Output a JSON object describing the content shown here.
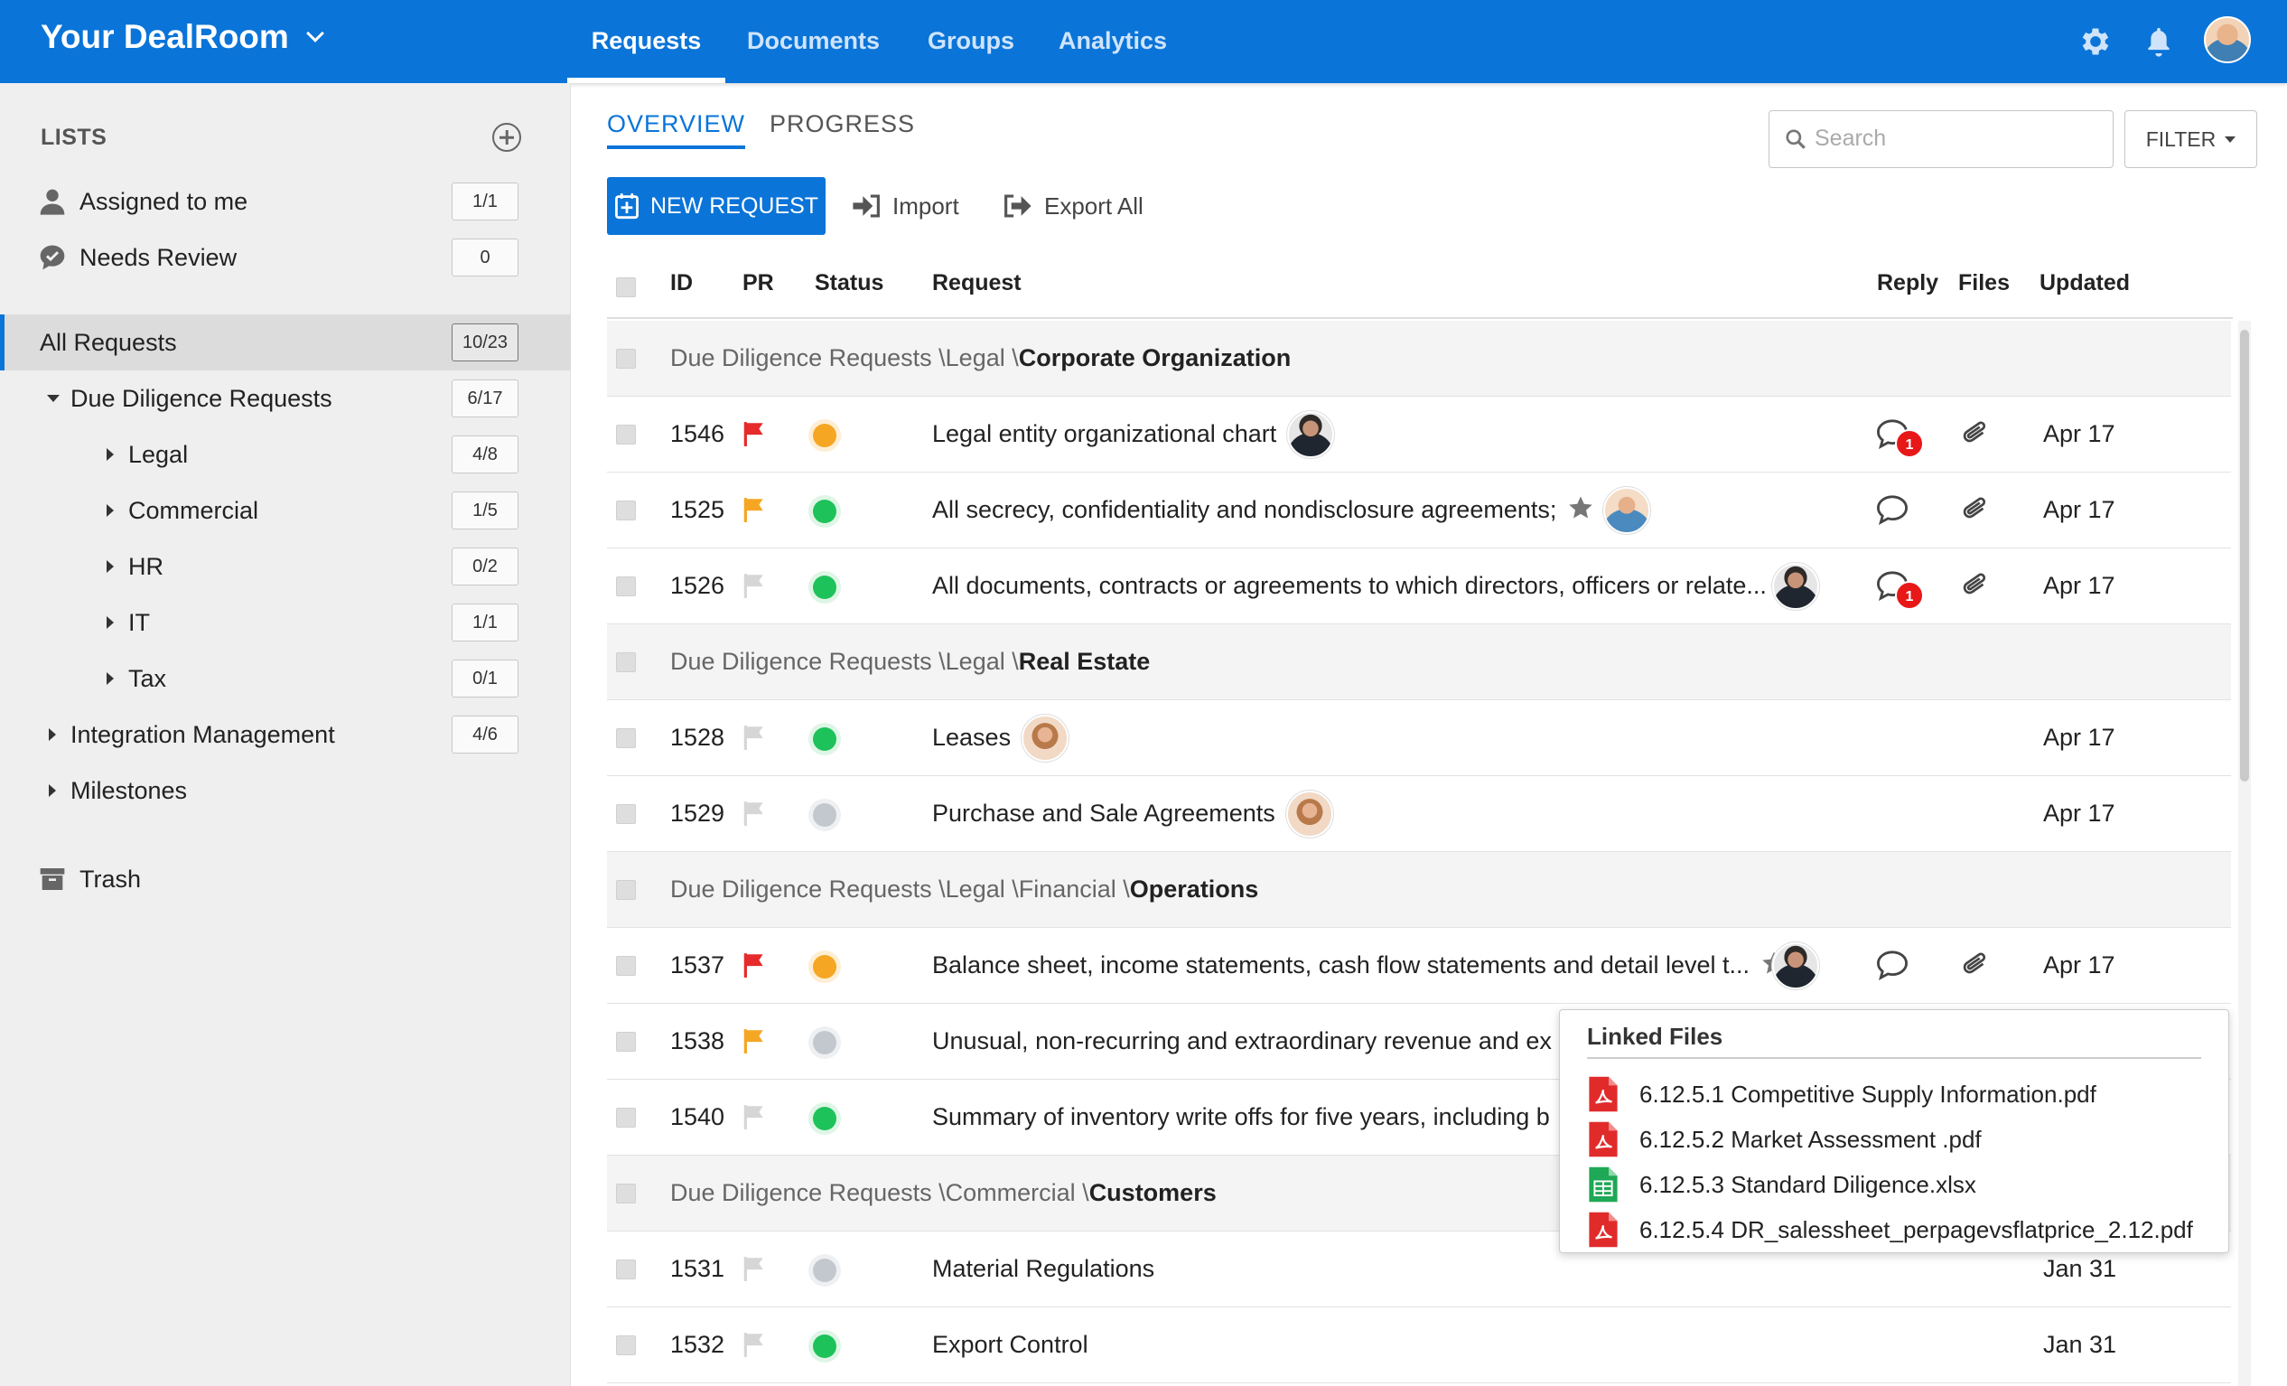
{
  "header": {
    "brand": "Your DealRoom",
    "tabs": [
      {
        "label": "Requests",
        "active": true
      },
      {
        "label": "Documents",
        "active": false
      },
      {
        "label": "Groups",
        "active": false
      },
      {
        "label": "Analytics",
        "active": false
      }
    ],
    "icons": [
      "gear-icon",
      "bell-icon",
      "user-avatar"
    ]
  },
  "sidebar": {
    "heading": "LISTS",
    "quick": [
      {
        "label": "Assigned to me",
        "count": "1/1",
        "icon": "user-icon"
      },
      {
        "label": "Needs Review",
        "count": "0",
        "icon": "chat-check-icon"
      }
    ],
    "tree": [
      {
        "label": "All Requests",
        "count": "10/23",
        "selected": true
      },
      {
        "label": "Due Diligence Requests",
        "count": "6/17",
        "expanded": true
      },
      {
        "label": "Legal",
        "count": "4/8"
      },
      {
        "label": "Commercial",
        "count": "1/5"
      },
      {
        "label": "HR",
        "count": "0/2"
      },
      {
        "label": "IT",
        "count": "1/1"
      },
      {
        "label": "Tax",
        "count": "0/1"
      },
      {
        "label": "Integration Management",
        "count": "4/6"
      },
      {
        "label": "Milestones",
        "count": ""
      }
    ],
    "trash": "Trash"
  },
  "main": {
    "subtabs": [
      {
        "label": "OVERVIEW",
        "active": true
      },
      {
        "label": "PROGRESS",
        "active": false
      }
    ],
    "search_placeholder": "Search",
    "filter_label": "FILTER",
    "new_request_label": "NEW REQUEST",
    "import_label": "Import",
    "export_label": "Export All",
    "columns": {
      "id": "ID",
      "pr": "PR",
      "status": "Status",
      "request": "Request",
      "reply": "Reply",
      "files": "Files",
      "updated": "Updated"
    }
  },
  "groups": [
    {
      "path": "Due Diligence Requests \\Legal \\",
      "name": "Corporate Organization",
      "rows": [
        {
          "id": "1546",
          "flag": "red",
          "status": "orange",
          "title": "Legal entity organizational chart",
          "star": false,
          "avatar": "man",
          "reply_count": "1",
          "files": true,
          "updated": "Apr 17"
        },
        {
          "id": "1525",
          "flag": "orange",
          "status": "green",
          "title": "All secrecy, confidentiality and nondisclosure agreements;",
          "star": true,
          "avatar": "young",
          "reply_count": "",
          "files": true,
          "updated": "Apr 17"
        },
        {
          "id": "1526",
          "flag": "grey",
          "status": "green",
          "title": "All documents, contracts or agreements to which directors, officers or relate...",
          "star": false,
          "avatar": "man",
          "reply_count": "1",
          "files": true,
          "updated": "Apr 17"
        }
      ]
    },
    {
      "path": "Due Diligence Requests \\Legal \\",
      "name": "Real Estate",
      "rows": [
        {
          "id": "1528",
          "flag": "grey",
          "status": "green",
          "title": "Leases",
          "star": false,
          "avatar": "woman",
          "reply_count": null,
          "files": false,
          "updated": "Apr 17"
        },
        {
          "id": "1529",
          "flag": "grey",
          "status": "grey",
          "title": "Purchase and Sale Agreements",
          "star": false,
          "avatar": "woman",
          "reply_count": null,
          "files": false,
          "updated": "Apr 17"
        }
      ]
    },
    {
      "path": "Due Diligence Requests \\Legal \\Financial \\",
      "name": "Operations",
      "rows": [
        {
          "id": "1537",
          "flag": "red",
          "status": "orange",
          "title": "Balance sheet, income statements, cash flow statements and detail level t...",
          "star": true,
          "avatar": "man",
          "reply_count": "",
          "files": true,
          "updated": "Apr 17"
        },
        {
          "id": "1538",
          "flag": "orange",
          "status": "grey",
          "title": "Unusual, non-recurring and extraordinary revenue and ex",
          "star": false,
          "avatar": null,
          "reply_count": null,
          "files": false,
          "updated": ""
        },
        {
          "id": "1540",
          "flag": "grey",
          "status": "green",
          "title": "Summary of inventory write offs for five years, including b",
          "star": false,
          "avatar": null,
          "reply_count": null,
          "files": false,
          "updated": ""
        }
      ]
    },
    {
      "path": "Due Diligence Requests \\Commercial \\",
      "name": "Customers",
      "rows": [
        {
          "id": "1531",
          "flag": "grey",
          "status": "grey",
          "title": "Material Regulations",
          "star": false,
          "avatar": null,
          "reply_count": null,
          "files": false,
          "updated": "Jan 31"
        },
        {
          "id": "1532",
          "flag": "grey",
          "status": "green",
          "title": "Export Control",
          "star": false,
          "avatar": null,
          "reply_count": null,
          "files": false,
          "updated": "Jan 31"
        }
      ]
    }
  ],
  "linked_files": {
    "title": "Linked Files",
    "files": [
      {
        "name": "6.12.5.1 Competitive Supply Information.pdf",
        "type": "pdf"
      },
      {
        "name": "6.12.5.2 Market Assessment .pdf",
        "type": "pdf"
      },
      {
        "name": "6.12.5.3 Standard Diligence.xlsx",
        "type": "xlsx"
      },
      {
        "name": "6.12.5.4 DR_salessheet_perpagevsflatprice_2.12.pdf",
        "type": "pdf"
      }
    ]
  },
  "colors": {
    "accent": "#0a74d8",
    "flag_red": "#e52b2b",
    "flag_orange": "#f5a623",
    "flag_grey": "#d6d6d6",
    "status_green": "#1ec25a",
    "status_orange": "#f5a623",
    "status_grey": "#c3c8cf",
    "pdf_red": "#e12b2b",
    "xlsx_green": "#1fa855"
  }
}
